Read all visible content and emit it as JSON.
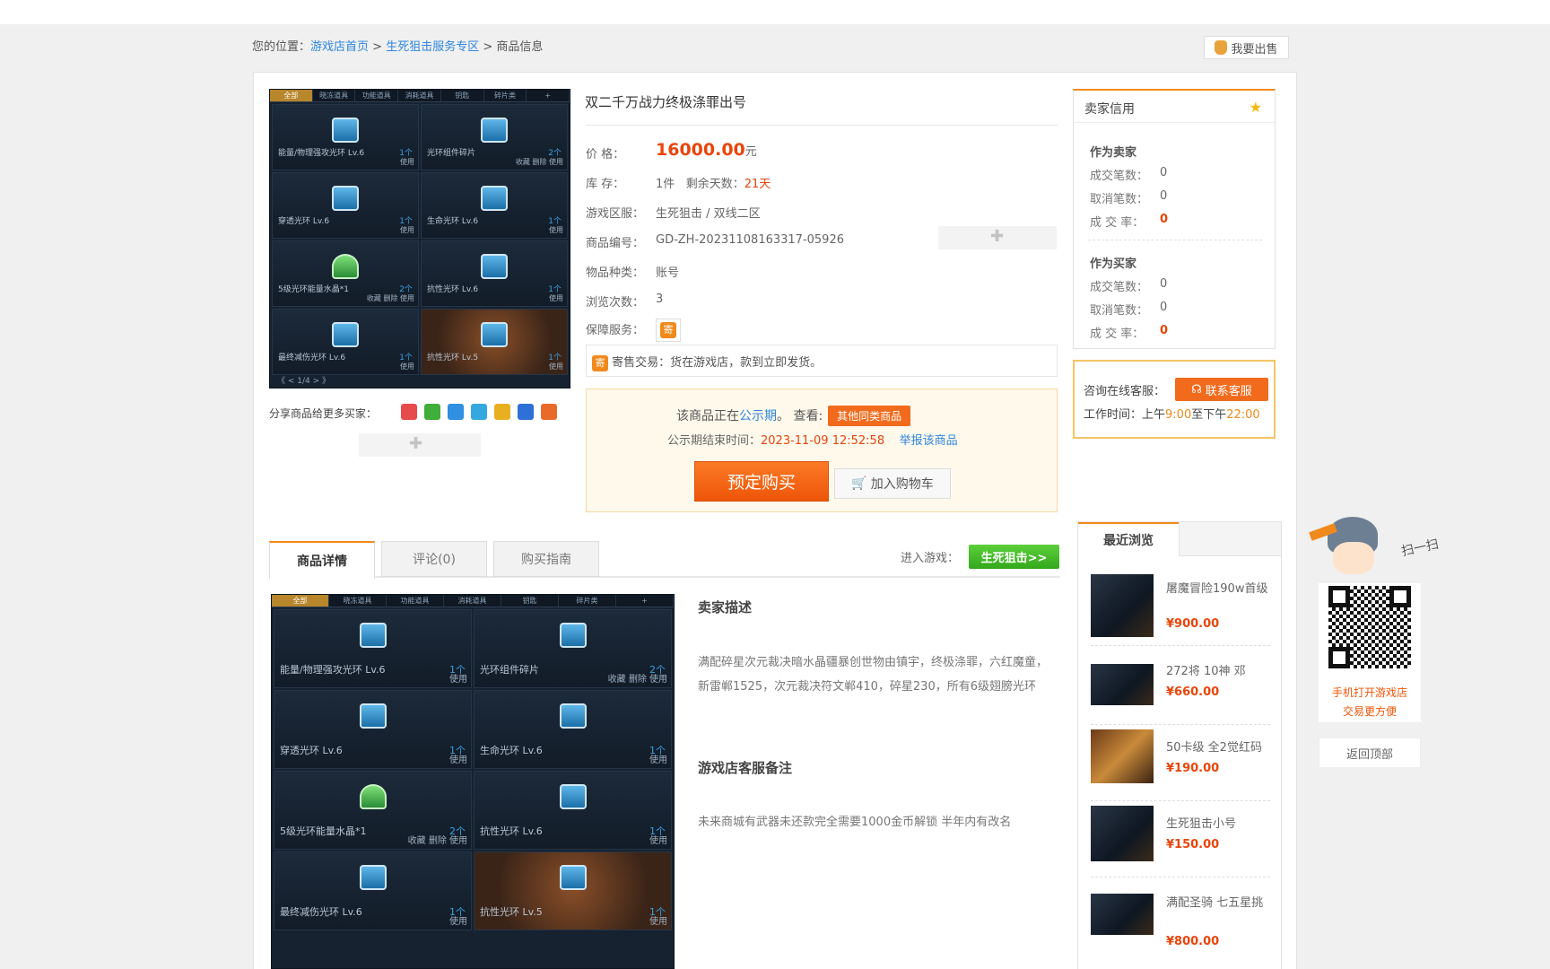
{
  "breadcrumb": {
    "prefix": "您的位置：",
    "home": "游戏店首页",
    "sep1": " > ",
    "zone": "生死狙击服务专区",
    "sep2": " > ",
    "current": "商品信息"
  },
  "sell_button": "我要出售",
  "product": {
    "title": "双二千万战力终极涤罪出号",
    "price_label": "价  格：",
    "price": "16000.00",
    "price_unit": "元",
    "stock_label": "库  存：",
    "stock": "1件",
    "days_label": "剩余天数：",
    "days": "21天",
    "server_label": "游戏区服：",
    "server": "生死狙击 / 双线二区",
    "id_label": "商品编号：",
    "id": "GD-ZH-20231108163317-05926",
    "type_label": "物品种类：",
    "type": "账号",
    "views_label": "浏览次数：",
    "views": "3",
    "service_label": "保障服务：",
    "service_icon": "寄",
    "consign_icon": "寄",
    "consign_text": "寄售交易：货在游戏店，款到立即发货。"
  },
  "notice": {
    "prefix": "该商品正在",
    "period": "公示期",
    "mid": "。 查看:",
    "same_btn": "其他同类商品",
    "end_label": "公示期结束时间：",
    "end_time": "2023-11-09 12:52:58",
    "report": "举报该商品"
  },
  "buy_button": "预定购买",
  "cart_button": "加入购物车",
  "share_label": "分享商品给更多买家：",
  "seller": {
    "title": "卖家信用",
    "as_seller": "作为卖家",
    "as_buyer": "作为买家",
    "deals_label": "成交笔数：",
    "cancel_label": "取消笔数：",
    "rate_label": "成 交 率：",
    "s_deals": "0",
    "s_cancel": "0",
    "s_rate": "0",
    "b_deals": "0",
    "b_cancel": "0",
    "b_rate": "0"
  },
  "service": {
    "ask": "咨询在线客服：",
    "btn": "联系客服",
    "hours_prefix": "工作时间：上午",
    "start": "9:00",
    "to": "至下午",
    "end": "22:00"
  },
  "tabs": [
    "商品详情",
    "评论(0)",
    "购买指南"
  ],
  "enter_label": "进入游戏：",
  "game_button": "生死狙击>>",
  "seller_desc_title": "卖家描述",
  "seller_desc": "满配碎星次元裁决暗水晶疆暴创世物由镇宇，终极涤罪，六红魔童，新雷郸1525，次元裁决符文郸410，碎星230，所有6级翅膀光环",
  "remark_title": "游戏店客服备注",
  "remark": "未来商城有武器未还款完全需要1000金币解锁 半年内有改名",
  "recent": {
    "title": "最近浏览",
    "items": [
      {
        "name": "屠魔冒险190w首级",
        "price": "¥900.00"
      },
      {
        "name": "272将 10神 邓",
        "price": "¥660.00"
      },
      {
        "name": "50卡级 全2觉红码",
        "price": "¥190.00"
      },
      {
        "name": "生死狙击小号",
        "price": "¥150.00"
      },
      {
        "name": "满配圣骑 七五星挑",
        "price": "¥800.00"
      }
    ]
  },
  "qr": {
    "sao": "扫一扫",
    "line1": "手机打开游戏店",
    "line2": "交易更方便"
  },
  "back_top": "返回顶部",
  "shot": {
    "tabs": [
      "全部",
      "晓冻道具",
      "功能道具",
      "消耗道具",
      "钥匙",
      "碎片类",
      "+"
    ],
    "cells": [
      {
        "name": "能量/物理强攻光环 Lv.6",
        "count": "1个",
        "btn": "使用"
      },
      {
        "name": "光环组件碎片",
        "count": "2个",
        "btn": "收藏 删除 使用"
      },
      {
        "name": "穿透光环 Lv.6",
        "count": "1个",
        "btn": "使用"
      },
      {
        "name": "生命光环 Lv.6",
        "count": "1个",
        "btn": "使用"
      },
      {
        "name": "5级光环能量水晶*1",
        "count": "2个",
        "btn": "收藏 删除 使用"
      },
      {
        "name": "抗性光环 Lv.6",
        "count": "1个",
        "btn": "使用"
      },
      {
        "name": "最终减伤光环 Lv.6",
        "count": "1个",
        "btn": "使用"
      },
      {
        "name": "抗性光环 Lv.5",
        "count": "1个",
        "btn": "使用"
      }
    ],
    "pager": "《  <  1/4  >  》"
  }
}
